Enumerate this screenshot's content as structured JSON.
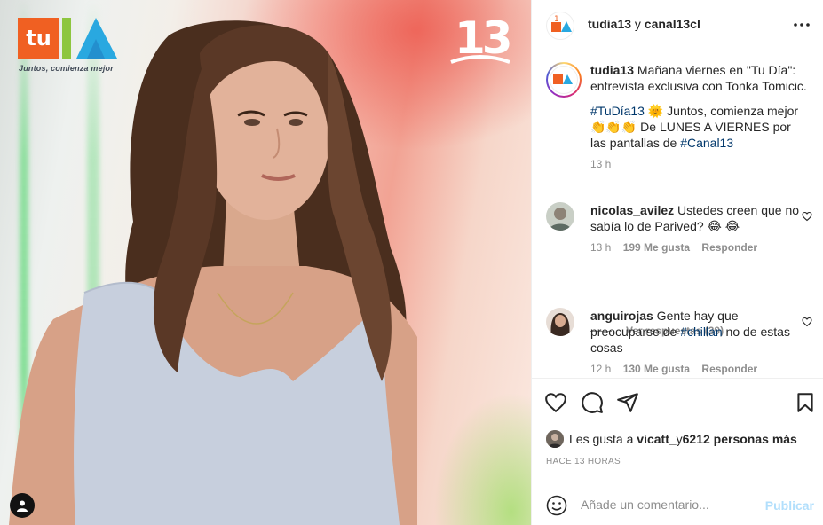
{
  "photo": {
    "logo_box_text": "tu",
    "logo_tagline": "Juntos, comienza mejor",
    "channel_number": "13",
    "user_tag_icon": "person-icon"
  },
  "header": {
    "account": "tudia13",
    "joiner": " y ",
    "collab": "canal13cl",
    "more_icon": "ellipsis-icon"
  },
  "caption": {
    "username": "tudia13",
    "text_1": " Mañana viernes en \"Tu Día\": entrevista exclusiva con Tonka Tomicic.",
    "hashtag_1": "#TuDía13",
    "emoji_sun": "🌞",
    "text_2": " Juntos, comienza mejor",
    "emoji_clap": "👏👏👏",
    "text_3": " De LUNES A VIERNES por las pantallas de ",
    "hashtag_2": "#Canal13",
    "time": "13 h"
  },
  "comments": [
    {
      "username": "nicolas_avilez",
      "text": " Ustedes creen que no sabía lo de Parived? 😂 😂",
      "time": "13 h",
      "likes": "199 Me gusta",
      "reply": "Responder"
    },
    {
      "username": "anguirojas",
      "text_before": " Gente hay que preocuparse de ",
      "hashtag": "#chillan",
      "text_after": " no de estas cosas",
      "time": "12 h",
      "likes": "130 Me gusta",
      "reply": "Responder"
    }
  ],
  "view_replies": "Ver respuestas (39)",
  "likes": {
    "prefix": "Les gusta a ",
    "user": "vicatt_",
    "middle": " y ",
    "count": "6212 personas más"
  },
  "date": "HACE 13 HORAS",
  "add_comment": {
    "placeholder": "Añade un comentario...",
    "publish": "Publicar"
  },
  "colors": {
    "link": "#00376b",
    "muted": "#8e8e8e",
    "publish_disabled": "#b2dffc",
    "logo_orange": "#f06022"
  }
}
